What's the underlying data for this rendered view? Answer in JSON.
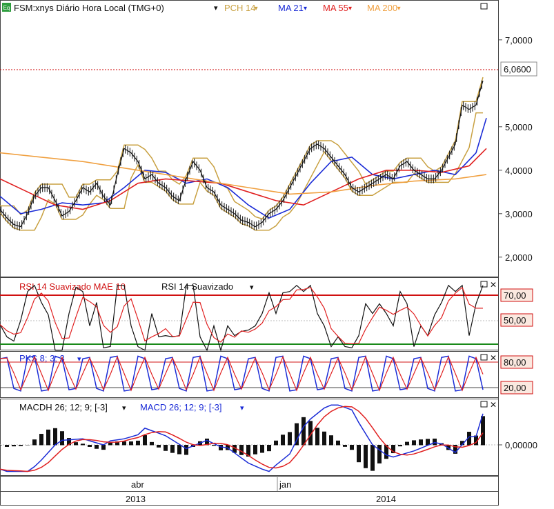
{
  "header": {
    "badge": "Eq",
    "title": "FSM:xnys Diário Hora Local (TMG+0)",
    "indicators": [
      {
        "label": "PCH 14",
        "color": "#c8a040"
      },
      {
        "label": "MA 21",
        "color": "#1a2bd6"
      },
      {
        "label": "MA 55",
        "color": "#e02020"
      },
      {
        "label": "MA 200",
        "color": "#f0a040"
      }
    ]
  },
  "price_panel": {
    "last_price_label": "6,0600",
    "ylim": [
      1.6,
      7.6
    ],
    "ticks": [
      {
        "v": 7,
        "label": "7,0000"
      },
      {
        "v": 5,
        "label": "5,0000"
      },
      {
        "v": 4,
        "label": "4,0000"
      },
      {
        "v": 3,
        "label": "3,0000"
      },
      {
        "v": 2,
        "label": "2,0000"
      }
    ]
  },
  "rsi_panel": {
    "title_a": "RSI 14 Suavizado MAE 10",
    "title_b": "RSI 14 Suavizado",
    "levels": [
      {
        "v": 70,
        "label": "70,00"
      },
      {
        "v": 50,
        "label": "50,00"
      }
    ]
  },
  "pks_panel": {
    "title": "PKS 8; 3; 3",
    "levels": [
      {
        "v": 80,
        "label": "80,00"
      },
      {
        "v": 20,
        "label": "20,00"
      }
    ]
  },
  "macd_panel": {
    "title_a": "MACDH 26; 12; 9; [-3]",
    "title_b": "MACD 26; 12; 9; [-3]",
    "zero_label": "0,00000"
  },
  "time_axis": {
    "months": [
      {
        "label": "abr",
        "x": 0.2
      },
      {
        "label": "jan",
        "x": 0.55
      }
    ],
    "years": [
      {
        "label": "2013",
        "x": 0.2
      },
      {
        "label": "2014",
        "x": 0.55
      }
    ]
  },
  "chart_data": {
    "type": "line",
    "title": "FSM:xnys Diário Hora Local (TMG+0)",
    "series": [
      {
        "name": "FSM:xnys",
        "x": [
          0,
          10,
          20,
          30,
          40,
          50,
          60,
          70,
          80,
          90,
          100,
          110,
          120,
          130,
          140,
          150,
          160,
          170,
          180,
          190,
          200,
          210,
          220,
          230,
          240,
          250,
          260,
          270,
          280,
          290,
          300,
          310,
          320,
          330,
          340,
          350,
          360,
          370,
          380,
          390,
          400,
          410,
          420,
          430,
          440,
          450,
          460,
          470,
          480,
          490,
          500,
          510,
          520,
          530,
          540,
          550,
          560,
          570,
          580,
          590,
          600,
          610,
          620,
          630,
          640,
          650,
          660,
          670,
          680,
          690,
          700
        ],
        "values": [
          3.1,
          2.9,
          2.75,
          2.7,
          3.0,
          3.4,
          3.6,
          3.6,
          3.3,
          2.95,
          3.05,
          3.3,
          3.6,
          3.5,
          3.7,
          3.4,
          3.2,
          3.9,
          4.5,
          4.4,
          4.2,
          3.8,
          3.9,
          3.7,
          3.6,
          3.4,
          3.3,
          3.8,
          4.2,
          4.0,
          3.6,
          3.5,
          3.2,
          3.1,
          3.0,
          2.85,
          2.8,
          2.7,
          2.8,
          3.0,
          3.1,
          3.3,
          3.6,
          3.9,
          4.2,
          4.5,
          4.6,
          4.5,
          4.3,
          4.1,
          3.9,
          3.6,
          3.5,
          3.6,
          3.7,
          3.8,
          3.9,
          3.8,
          4.1,
          4.2,
          4.0,
          3.9,
          3.8,
          3.8,
          4.0,
          4.3,
          4.6,
          5.5,
          5.4,
          5.5,
          6.06
        ]
      },
      {
        "name": "MA 21",
        "x": [
          0,
          30,
          60,
          90,
          120,
          150,
          180,
          210,
          240,
          270,
          300,
          330,
          360,
          390,
          420,
          450,
          480,
          510,
          540,
          570,
          600,
          630,
          660,
          690,
          705
        ],
        "values": [
          3.4,
          3.0,
          3.1,
          3.25,
          3.2,
          3.25,
          3.6,
          4.0,
          3.95,
          3.7,
          3.8,
          3.6,
          3.2,
          2.9,
          3.1,
          3.7,
          4.2,
          4.3,
          3.9,
          3.8,
          3.9,
          4.0,
          3.9,
          4.4,
          5.2
        ]
      },
      {
        "name": "MA 55",
        "x": [
          0,
          40,
          80,
          120,
          160,
          200,
          240,
          280,
          320,
          360,
          400,
          440,
          480,
          520,
          560,
          600,
          640,
          680,
          705
        ],
        "values": [
          3.8,
          3.5,
          3.2,
          3.1,
          3.3,
          3.7,
          3.8,
          3.75,
          3.7,
          3.5,
          3.3,
          3.2,
          3.5,
          3.8,
          4.0,
          4.0,
          3.95,
          4.1,
          4.5
        ]
      },
      {
        "name": "MA 200",
        "x": [
          0,
          60,
          120,
          180,
          240,
          300,
          360,
          420,
          480,
          540,
          600,
          660,
          705
        ],
        "values": [
          4.4,
          4.3,
          4.2,
          4.05,
          3.9,
          3.75,
          3.6,
          3.45,
          3.5,
          3.65,
          3.75,
          3.8,
          3.9
        ]
      }
    ],
    "ylim": [
      1.6,
      7.6
    ]
  }
}
